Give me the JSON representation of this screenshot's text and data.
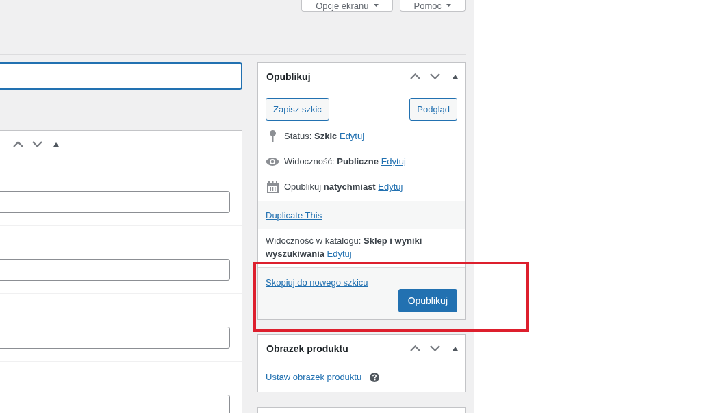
{
  "screen_options": [
    {
      "label": "Opcje ekranu"
    },
    {
      "label": "Pomoc"
    }
  ],
  "title_field": {
    "focused": true
  },
  "main_box": {
    "expanded": true,
    "fields": [
      {
        "focused": false
      },
      {
        "focused": false
      },
      {
        "focused": false
      },
      {
        "focused": false
      }
    ]
  },
  "publish_box": {
    "title": "Opublikuj",
    "expanded": true,
    "save_draft_button": "Zapisz szkic",
    "preview_button": "Podgląd",
    "status_rows": [
      {
        "kind": "status",
        "label": "Status:",
        "value": "Szkic",
        "link": "Edytuj"
      },
      {
        "kind": "visibility",
        "label": "Widoczność:",
        "value": "Publiczne",
        "link": "Edytuj"
      },
      {
        "kind": "schedule",
        "label": "Opublikuj",
        "value": "natychmiast",
        "link": "Edytuj"
      }
    ],
    "duplicate_link": "Duplicate This",
    "catalog_visibility": {
      "label": "Widoczność w katalogu:",
      "value": "Sklep i wyniki wyszukiwania",
      "link": "Edytuj"
    },
    "copy_link": "Skopiuj do nowego szkicu",
    "publish_button": "Opublikuj"
  },
  "product_image_box": {
    "title": "Obrazek produktu",
    "expanded": true,
    "link": "Ustaw obrazek produktu"
  }
}
